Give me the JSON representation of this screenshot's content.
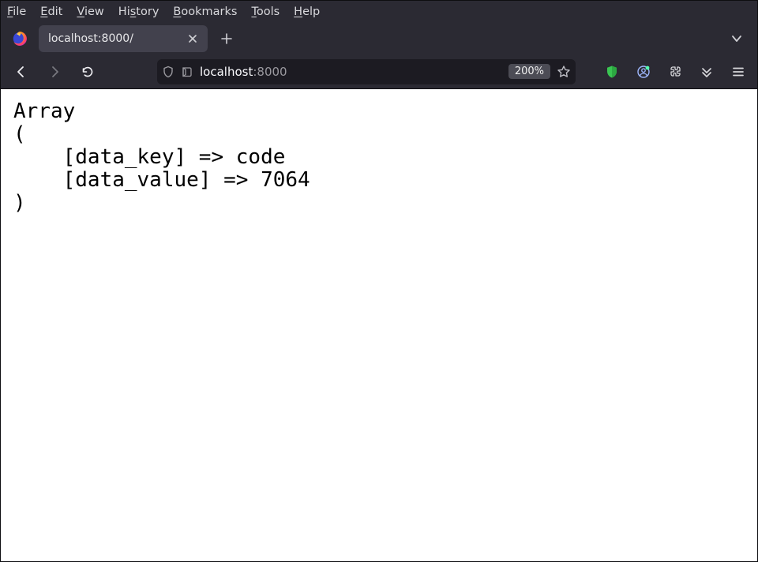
{
  "menu": {
    "file": {
      "u": "F",
      "rest": "ile"
    },
    "edit": {
      "u": "E",
      "rest": "dit"
    },
    "view": {
      "u": "V",
      "rest": "iew"
    },
    "history": {
      "pre": "Hi",
      "u": "s",
      "rest": "tory"
    },
    "bookmarks": {
      "u": "B",
      "rest": "ookmarks"
    },
    "tools": {
      "u": "T",
      "rest": "ools"
    },
    "help": {
      "u": "H",
      "rest": "elp"
    }
  },
  "tab": {
    "title": "localhost:8000/"
  },
  "url": {
    "host": "localhost",
    "port": ":8000"
  },
  "zoom": "200%",
  "page": {
    "line1": "Array",
    "line2": "(",
    "line3": "    [data_key] => code",
    "line4": "    [data_value] => 7064",
    "line5": ")"
  }
}
